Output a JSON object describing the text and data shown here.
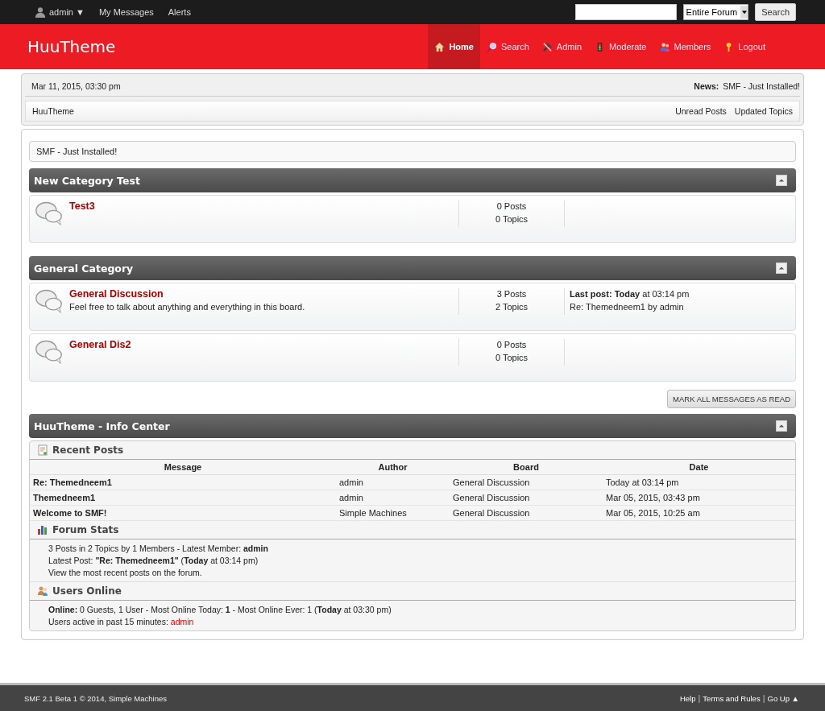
{
  "topbar": {
    "user": "admin ▼",
    "links": [
      "My Messages",
      "Alerts"
    ],
    "search": {
      "scope": "Entire Forum",
      "button": "Search"
    }
  },
  "header": {
    "title": "HuuTheme",
    "nav": [
      {
        "label": "Home",
        "selected": true
      },
      {
        "label": "Search",
        "selected": false
      },
      {
        "label": "Admin",
        "selected": false
      },
      {
        "label": "Moderate",
        "selected": false
      },
      {
        "label": "Members",
        "selected": false
      },
      {
        "label": "Logout",
        "selected": false
      }
    ]
  },
  "upper": {
    "date": "Mar 11, 2015, 03:30 pm",
    "news_label": "News:",
    "news": "SMF - Just Installed!",
    "breadcrumb": "HuuTheme",
    "links": [
      "Unread Posts",
      "Updated Topics"
    ]
  },
  "notice": "SMF - Just Installed!",
  "categories": [
    {
      "title": "New Category Test",
      "boards": [
        {
          "name": "Test3",
          "posts": "0 Posts",
          "topics": "0 Topics"
        }
      ]
    },
    {
      "title": "General Category",
      "boards": [
        {
          "name": "General Discussion",
          "description": "Feel free to talk about anything and everything in this board.",
          "posts": "3 Posts",
          "topics": "2 Topics",
          "last_post": "**Last post:** **Today** at 03:14 pm",
          "last_post_detail": "Re: Themedneem1 by admin"
        },
        {
          "name": "General Dis2",
          "posts": "0 Posts",
          "topics": "0 Topics"
        }
      ]
    }
  ],
  "mark_read_button": "MARK ALL MESSAGES AS READ",
  "info_center": {
    "title": "HuuTheme - Info Center",
    "recent_posts": {
      "title": "Recent Posts",
      "columns": [
        "Message",
        "Author",
        "Board",
        "Date"
      ],
      "rows": [
        [
          "Re: Themedneem1",
          "admin",
          "General Discussion",
          "Today at 03:14 pm"
        ],
        [
          "Themedneem1",
          "admin",
          "General Discussion",
          "Mar 05, 2015, 03:43 pm"
        ],
        [
          "Welcome to SMF!",
          "Simple Machines",
          "General Discussion",
          "Mar 05, 2015, 10:25 am"
        ]
      ]
    },
    "forum_stats": {
      "title": "Forum Stats",
      "lines": [
        "3 Posts in 2 Topics by 1 Members - Latest Member: **admin**",
        "Latest Post: **\"Re: Themedneem1\"** (**Today** at 03:14 pm)",
        "View the most recent posts on the forum."
      ]
    },
    "users_online": {
      "title": "Users Online",
      "line": "**Online:** 0 Guests, 1 User  - Most Online Today: **1** -  Most Online Ever: 1 (**Today** at 03:30 pm)",
      "active_label": "Users active in past 15 minutes:",
      "active_user": "admin"
    }
  },
  "footer": {
    "copyright": "SMF 2.1 Beta 1 © 2014, Simple Machines",
    "links": [
      {
        "kind": "link",
        "text": "Help"
      },
      {
        "kind": "separator",
        "text": "|"
      },
      {
        "kind": "link",
        "text": "Terms and Rules"
      },
      {
        "kind": "separator",
        "text": "|"
      },
      {
        "kind": "link",
        "text": "Go Up ▲"
      }
    ]
  }
}
